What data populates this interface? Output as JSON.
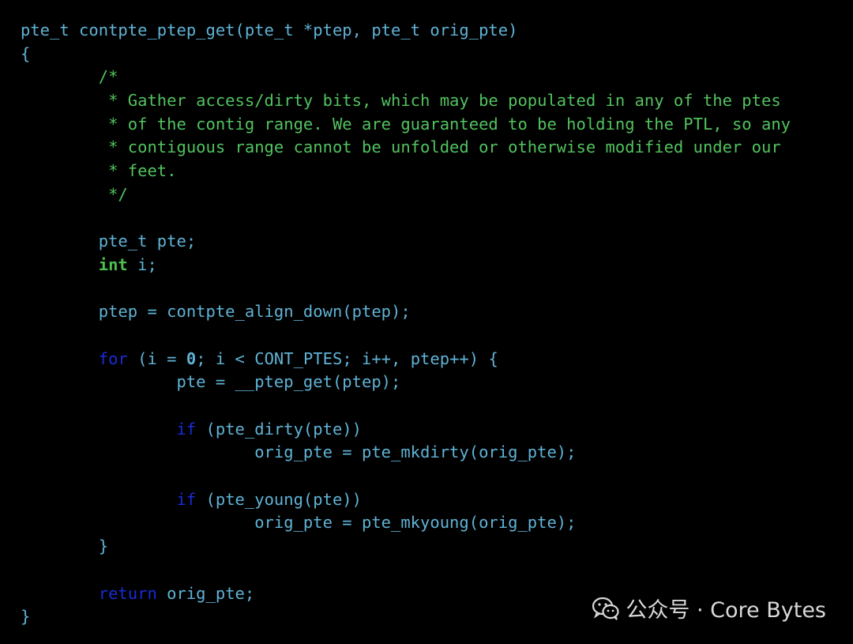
{
  "colors": {
    "background": "#000000",
    "code": "#5fb3d6",
    "comment": "#52c25f",
    "keyword": "#1a2bd6",
    "type": "#4cbf4f",
    "watermark": "#d9d9d9"
  },
  "code_lines": [
    [
      {
        "t": "plain",
        "s": "pte_t contpte_ptep_get(pte_t *ptep, pte_t orig_pte)"
      }
    ],
    [
      {
        "t": "plain",
        "s": "{"
      }
    ],
    [
      {
        "t": "comment",
        "s": "        /*"
      }
    ],
    [
      {
        "t": "comment",
        "s": "         * Gather access/dirty bits, which may be populated in any of the ptes"
      }
    ],
    [
      {
        "t": "comment",
        "s": "         * of the contig range. We are guaranteed to be holding the PTL, so any"
      }
    ],
    [
      {
        "t": "comment",
        "s": "         * contiguous range cannot be unfolded or otherwise modified under our"
      }
    ],
    [
      {
        "t": "comment",
        "s": "         * feet."
      }
    ],
    [
      {
        "t": "comment",
        "s": "         */"
      }
    ],
    [],
    [
      {
        "t": "plain",
        "s": "        pte_t pte;"
      }
    ],
    [
      {
        "t": "plain",
        "s": "        "
      },
      {
        "t": "type",
        "s": "int"
      },
      {
        "t": "plain",
        "s": " i;"
      }
    ],
    [],
    [
      {
        "t": "plain",
        "s": "        ptep = contpte_align_down(ptep);"
      }
    ],
    [],
    [
      {
        "t": "plain",
        "s": "        "
      },
      {
        "t": "keyword",
        "s": "for"
      },
      {
        "t": "plain",
        "s": " (i = "
      },
      {
        "t": "number",
        "s": "0"
      },
      {
        "t": "plain",
        "s": "; i < CONT_PTES; i++, ptep++) {"
      }
    ],
    [
      {
        "t": "plain",
        "s": "                pte = __ptep_get(ptep);"
      }
    ],
    [],
    [
      {
        "t": "plain",
        "s": "                "
      },
      {
        "t": "keyword",
        "s": "if"
      },
      {
        "t": "plain",
        "s": " (pte_dirty(pte))"
      }
    ],
    [
      {
        "t": "plain",
        "s": "                        orig_pte = pte_mkdirty(orig_pte);"
      }
    ],
    [],
    [
      {
        "t": "plain",
        "s": "                "
      },
      {
        "t": "keyword",
        "s": "if"
      },
      {
        "t": "plain",
        "s": " (pte_young(pte))"
      }
    ],
    [
      {
        "t": "plain",
        "s": "                        orig_pte = pte_mkyoung(orig_pte);"
      }
    ],
    [
      {
        "t": "plain",
        "s": "        }"
      }
    ],
    [],
    [
      {
        "t": "plain",
        "s": "        "
      },
      {
        "t": "keyword",
        "s": "return"
      },
      {
        "t": "plain",
        "s": " orig_pte;"
      }
    ],
    [
      {
        "t": "plain",
        "s": "}"
      }
    ]
  ],
  "watermark": {
    "icon": "wechat-icon",
    "text": "公众号 · Core Bytes"
  }
}
